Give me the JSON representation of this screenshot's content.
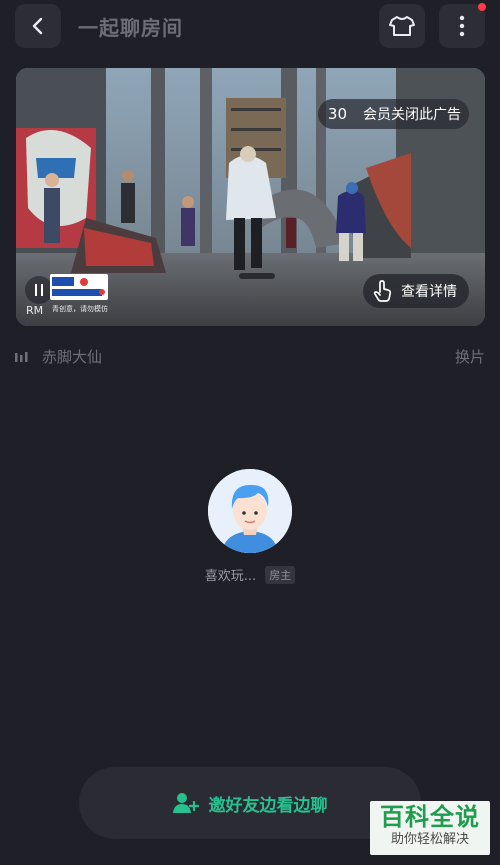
{
  "header": {
    "title": "一起聊房间",
    "back_icon": "chevron-left-icon",
    "shirt_icon": "tshirt-icon",
    "more_icon": "more-vertical-icon"
  },
  "video": {
    "ad_countdown": "30",
    "ad_close_text": "会员关闭此广告",
    "detail_button": "查看详情",
    "detail_icon": "hand-pointer-icon",
    "brand_caption": "青创意，请勿模仿",
    "rm_text": "RM"
  },
  "music": {
    "song_name": "赤脚大仙",
    "switch_label": "换片"
  },
  "host": {
    "name": "喜欢玩...",
    "badge": "房主"
  },
  "invite": {
    "label": "邀好友边看边聊",
    "icon": "add-user-icon"
  },
  "watermark": {
    "title": "百科全说",
    "subtitle": "助你轻松解决"
  },
  "colors": {
    "background": "#1f2027",
    "accent_green": "#28c08e",
    "notification_dot": "#ff3b4a"
  }
}
